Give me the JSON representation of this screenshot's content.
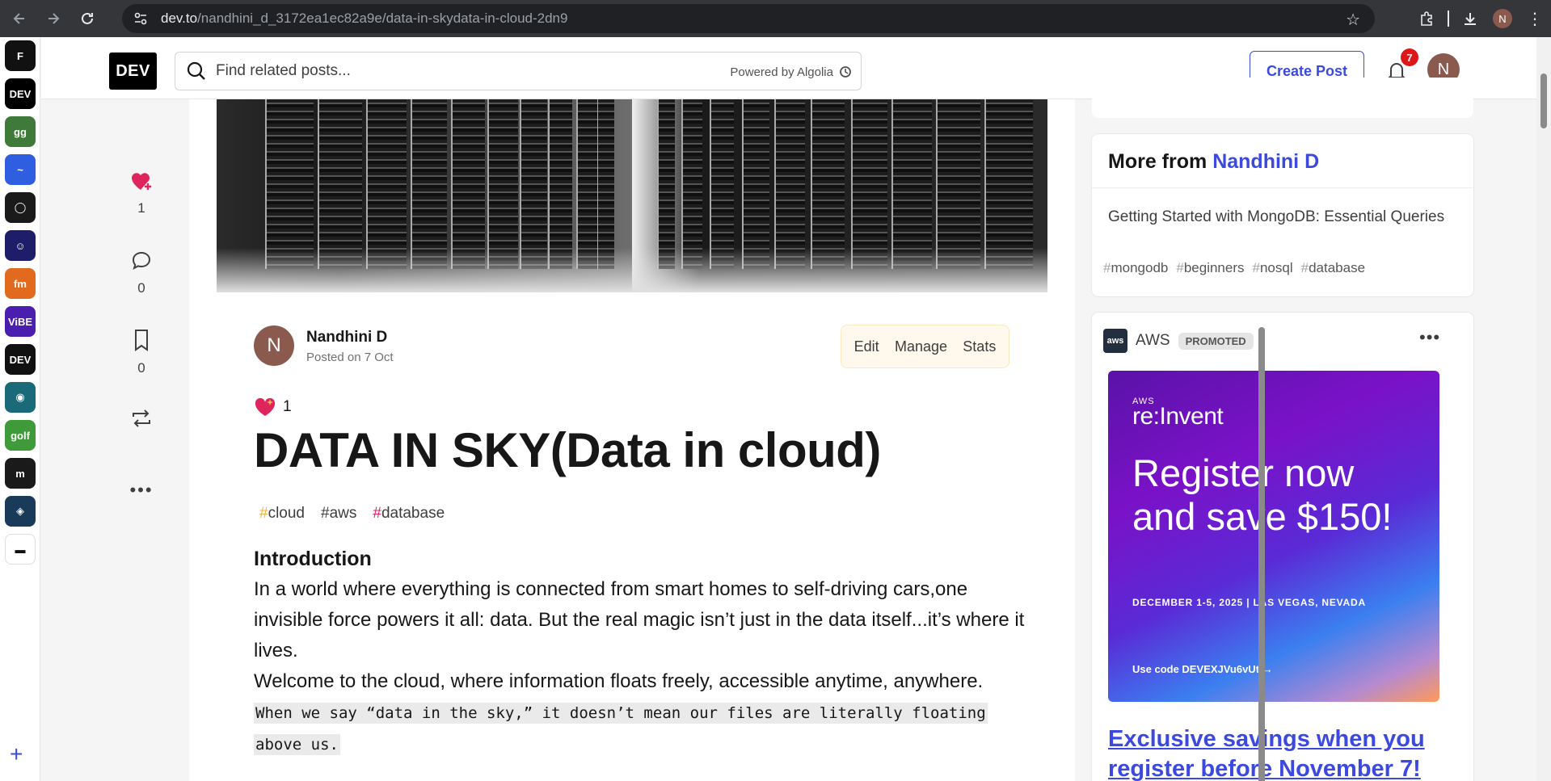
{
  "browser": {
    "url_host": "dev.to",
    "url_path": "/nandhini_d_3172ea1ec82a9e/data-in-skydata-in-cloud-2dn9",
    "profile_initial": "N"
  },
  "apps": [
    {
      "name": "app-f",
      "label": "F",
      "color": "#111111"
    },
    {
      "name": "app-dev",
      "label": "DEV",
      "color": "#000000"
    },
    {
      "name": "app-gg",
      "label": "gg",
      "color": "#3f7a3a"
    },
    {
      "name": "app-wave",
      "label": "~",
      "color": "#2f5fe0"
    },
    {
      "name": "app-chat",
      "label": "◯",
      "color": "#1a1a1a"
    },
    {
      "name": "app-robot",
      "label": "☺",
      "color": "#1d1d6a"
    },
    {
      "name": "app-fm",
      "label": "fm",
      "color": "#e26a1f"
    },
    {
      "name": "app-vibe",
      "label": "ViBE",
      "color": "#4a1fb0"
    },
    {
      "name": "app-dumbdev",
      "label": "DEV",
      "color": "#111111"
    },
    {
      "name": "app-drop",
      "label": "◉",
      "color": "#1b6a7a"
    },
    {
      "name": "app-golf",
      "label": "golf",
      "color": "#3f9a3a"
    },
    {
      "name": "app-m",
      "label": "m",
      "color": "#1a1a1a"
    },
    {
      "name": "app-shield",
      "label": "◈",
      "color": "#1a3a5a"
    },
    {
      "name": "app-bar",
      "label": "▬",
      "color": "#ffffff"
    }
  ],
  "header": {
    "logo": "DEV",
    "search_placeholder": "Find related posts...",
    "powered_by": "Powered by Algolia",
    "create_post": "Create Post",
    "notification_count": "7",
    "avatar_initial": "N"
  },
  "reactions": {
    "likes": "1",
    "comments": "0",
    "bookmarks": "0"
  },
  "article": {
    "author_initial": "N",
    "author": "Nandhini D",
    "posted": "Posted on 7 Oct",
    "actions": [
      "Edit",
      "Manage",
      "Stats"
    ],
    "reaction_count": "1",
    "title": "DATA IN SKY(Data in cloud)",
    "tags": [
      {
        "hash": "#",
        "name": "cloud",
        "color": "#f0b440"
      },
      {
        "hash": "#",
        "name": "aws",
        "color": "#3d3d3d"
      },
      {
        "hash": "#",
        "name": "database",
        "color": "#e0245e"
      }
    ],
    "heading": "Introduction",
    "para1": "In a world where everything is connected from smart homes to self-driving cars,one invisible force powers it all: data. But the real magic isn’t just in the data itself...it’s where it lives.",
    "para2": "Welcome to the cloud, where information floats freely, accessible anytime, anywhere.",
    "code1": "When we say “data in the sky,” it doesn’t mean our files are literally floating",
    "code2": "above us."
  },
  "sidebar": {
    "more_from_prefix": "More from",
    "more_from_author": "Nandhini D",
    "more_item_title": "Getting Started with MongoDB: Essential Queries",
    "more_item_tags": [
      "mongodb",
      "beginners",
      "nosql",
      "database"
    ],
    "ad": {
      "brand": "AWS",
      "badge": "PROMOTED",
      "event_small": "AWS",
      "event": "re:Invent",
      "headline": "Register now and save $150!",
      "dates": "DECEMBER 1-5, 2025 | LAS VEGAS, NEVADA",
      "code": "Use code DEVEXJVu6vUt  →",
      "link": "Exclusive savings when you register before November 7!"
    }
  }
}
